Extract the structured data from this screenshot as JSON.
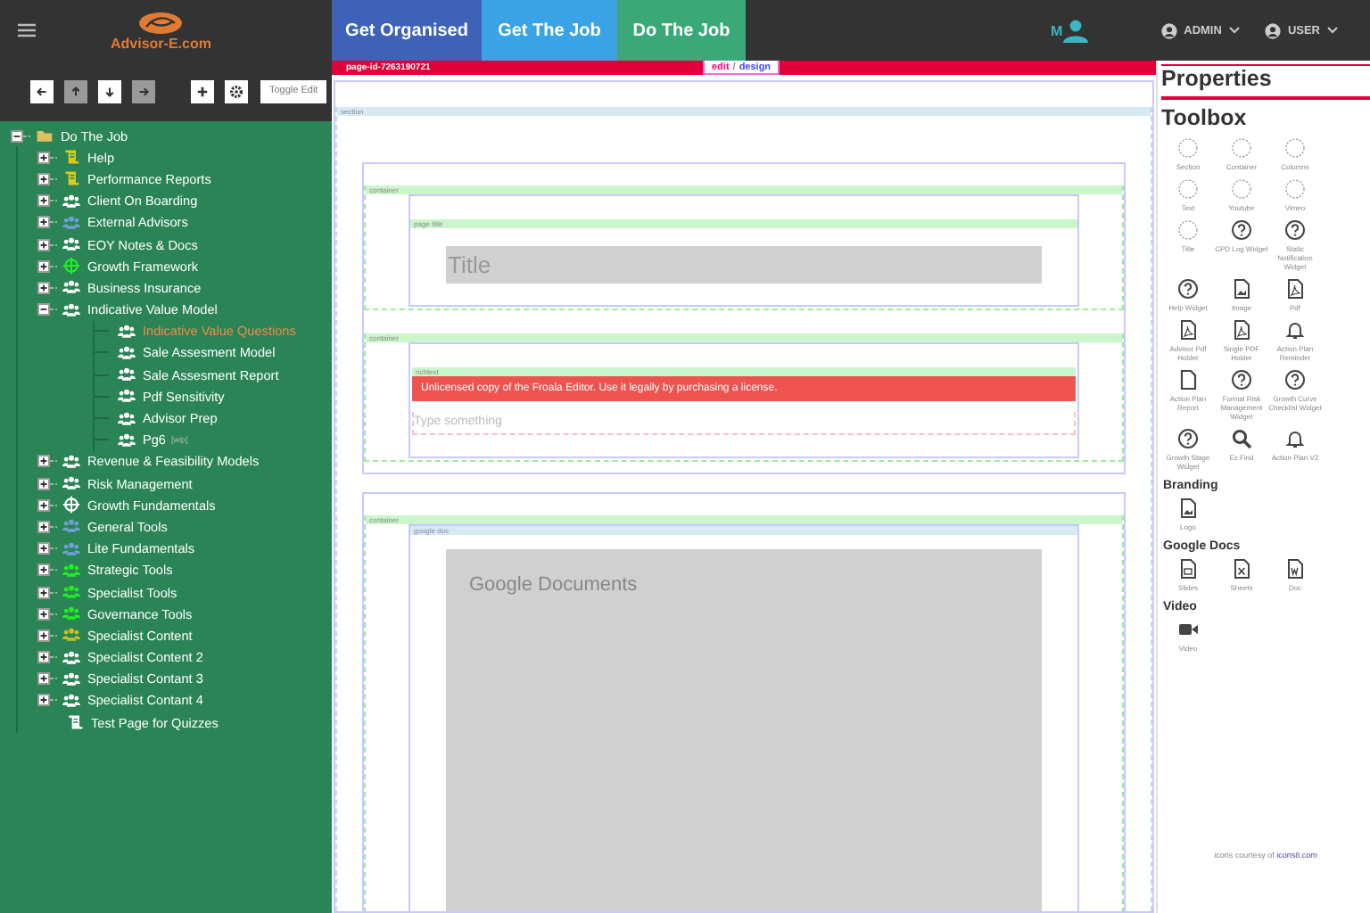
{
  "header": {
    "logo_text": "Advisor-E.com",
    "tabs": [
      {
        "label": "Get Organised",
        "color": "#3d62b8"
      },
      {
        "label": "Get The Job",
        "color": "#3aa3e6"
      },
      {
        "label": "Do The Job",
        "color": "#3aa878"
      }
    ],
    "avatar_letter": "M",
    "menus": [
      {
        "label": "ADMIN"
      },
      {
        "label": "USER"
      }
    ]
  },
  "toolbar": {
    "buttons": [
      {
        "kind": "left",
        "disabled": false
      },
      {
        "kind": "up",
        "disabled": true
      },
      {
        "kind": "down",
        "disabled": false
      },
      {
        "kind": "right",
        "disabled": true
      },
      {
        "kind": "plus",
        "disabled": false
      },
      {
        "kind": "gear",
        "disabled": false
      }
    ],
    "toggle_label": "Toggle Edit"
  },
  "tree": {
    "label": "Do The Job",
    "kind": "folder",
    "color": "#e0c060",
    "expanded": true,
    "selected": false,
    "children": [
      {
        "label": "Help",
        "kind": "scroll",
        "color": "#d8c820",
        "expanded": false,
        "selected": false
      },
      {
        "label": "Performance Reports",
        "kind": "scroll",
        "color": "#d8c820",
        "expanded": false,
        "selected": false
      },
      {
        "label": "Client On Boarding",
        "kind": "people",
        "color": "#ffffff",
        "expanded": false,
        "selected": false
      },
      {
        "label": "External Advisors",
        "kind": "people",
        "color": "#6fa0d8",
        "expanded": false,
        "selected": false
      },
      {
        "label": "EOY Notes & Docs",
        "kind": "people",
        "color": "#ffffff",
        "expanded": false,
        "selected": false
      },
      {
        "label": "Growth Framework",
        "kind": "target",
        "color": "#22ee22",
        "expanded": false,
        "selected": false
      },
      {
        "label": "Business Insurance",
        "kind": "people",
        "color": "#ffffff",
        "expanded": false,
        "selected": false
      },
      {
        "label": "Indicative Value Model",
        "kind": "people",
        "color": "#ffffff",
        "expanded": true,
        "selected": false,
        "children": [
          {
            "label": "Indicative Value Questions",
            "kind": "people",
            "color": "#ffffff",
            "selected": true
          },
          {
            "label": "Sale Assesment Model",
            "kind": "people",
            "color": "#ffffff",
            "selected": false
          },
          {
            "label": "Sale Assesment Report",
            "kind": "people",
            "color": "#ffffff",
            "selected": false
          },
          {
            "label": "Pdf Sensitivity",
            "kind": "people",
            "color": "#ffffff",
            "selected": false
          },
          {
            "label": "Advisor Prep",
            "kind": "people",
            "color": "#ffffff",
            "selected": false
          },
          {
            "label": "Pg6",
            "kind": "people",
            "color": "#ffffff",
            "selected": false,
            "badge": "[wip]"
          }
        ]
      },
      {
        "label": "Revenue & Feasibility Models",
        "kind": "people",
        "color": "#ffffff",
        "expanded": false,
        "selected": false
      },
      {
        "label": "Risk Management",
        "kind": "people",
        "color": "#ffffff",
        "expanded": false,
        "selected": false
      },
      {
        "label": "Growth Fundamentals",
        "kind": "target",
        "color": "#ffffff",
        "expanded": false,
        "selected": false
      },
      {
        "label": "General Tools",
        "kind": "people",
        "color": "#6fa0d8",
        "expanded": false,
        "selected": false
      },
      {
        "label": "Lite Fundamentals",
        "kind": "people",
        "color": "#6fa0d8",
        "expanded": false,
        "selected": false
      },
      {
        "label": "Strategic Tools",
        "kind": "people",
        "color": "#22ee22",
        "expanded": false,
        "selected": false
      },
      {
        "label": "Specialist Tools",
        "kind": "people",
        "color": "#22ee22",
        "expanded": false,
        "selected": false
      },
      {
        "label": "Governance Tools",
        "kind": "people",
        "color": "#22ee22",
        "expanded": false,
        "selected": false
      },
      {
        "label": "Specialist Content",
        "kind": "people",
        "color": "#c8c020",
        "expanded": false,
        "selected": false
      },
      {
        "label": "Specialist Content 2",
        "kind": "people",
        "color": "#ffffff",
        "expanded": false,
        "selected": false
      },
      {
        "label": "Specialist Contant 3",
        "kind": "people",
        "color": "#ffffff",
        "expanded": false,
        "selected": false
      },
      {
        "label": "Specialist Contant 4",
        "kind": "people",
        "color": "#ffffff",
        "expanded": false,
        "selected": false
      },
      {
        "label": "Test Page for Quizzes",
        "kind": "scroll",
        "color": "#ffffff",
        "selected": false
      }
    ]
  },
  "canvas": {
    "page_id": "page-id-7263190721",
    "modes": [
      {
        "label": "edit",
        "selected": false
      },
      {
        "label": "design",
        "selected": true
      }
    ],
    "mode_separator": "/",
    "section_label": "section",
    "groups": [
      {
        "containers": [
          {
            "label": "container",
            "block": {
              "kind": "title",
              "label": "page title",
              "placeholder": "Title"
            }
          },
          {
            "label": "container",
            "block": {
              "kind": "richtext",
              "label": "richtext",
              "banner": "Unlicensed copy of the Froala Editor. Use it legally by purchasing a license.",
              "placeholder": "Type something"
            }
          }
        ]
      },
      {
        "containers": [
          {
            "label": "container",
            "block": {
              "kind": "gdoc",
              "label": "google doc",
              "text": "Google Documents"
            }
          }
        ]
      }
    ]
  },
  "panel": {
    "title": "Properties",
    "toolbox_title": "Toolbox",
    "groups": [
      {
        "items": [
          {
            "label": "Section",
            "kind": "placeholder"
          },
          {
            "label": "Container",
            "kind": "placeholder"
          },
          {
            "label": "Columns",
            "kind": "placeholder"
          },
          {
            "label": "Text",
            "kind": "placeholder"
          },
          {
            "label": "Youtube",
            "kind": "placeholder"
          },
          {
            "label": "Vimeo",
            "kind": "placeholder"
          },
          {
            "label": "Title",
            "kind": "placeholder"
          },
          {
            "label": "CPD Log Widget",
            "kind": "help"
          },
          {
            "label": "Static Notification Widget",
            "kind": "help"
          },
          {
            "label": "Help Widget",
            "kind": "help"
          },
          {
            "label": "Image",
            "kind": "image"
          },
          {
            "label": "Pdf",
            "kind": "pdf"
          },
          {
            "label": "Advisor Pdf Holder",
            "kind": "pdf"
          },
          {
            "label": "Single PDF Holder",
            "kind": "pdf"
          },
          {
            "label": "Action Plan Reminder",
            "kind": "bell"
          },
          {
            "label": "Action Plan Report",
            "kind": "file"
          },
          {
            "label": "Formal Risk Management Widget",
            "kind": "help"
          },
          {
            "label": "Growth Curve Checklist Widget",
            "kind": "help"
          },
          {
            "label": "Growth Stage Widget",
            "kind": "help"
          },
          {
            "label": "Ez Find",
            "kind": "search"
          },
          {
            "label": "Action Plan V2",
            "kind": "bell"
          }
        ]
      },
      {
        "title": "Branding",
        "items": [
          {
            "label": "Logo",
            "kind": "image"
          }
        ]
      },
      {
        "title": "Google Docs",
        "items": [
          {
            "label": "Slides",
            "kind": "slides"
          },
          {
            "label": "Sheets",
            "kind": "sheets"
          },
          {
            "label": "Doc",
            "kind": "doc"
          }
        ]
      },
      {
        "title": "Video",
        "items": [
          {
            "label": "Video",
            "kind": "video"
          }
        ]
      }
    ],
    "credit_text": "icons courtesy of",
    "credit_link": "icons8.com"
  }
}
